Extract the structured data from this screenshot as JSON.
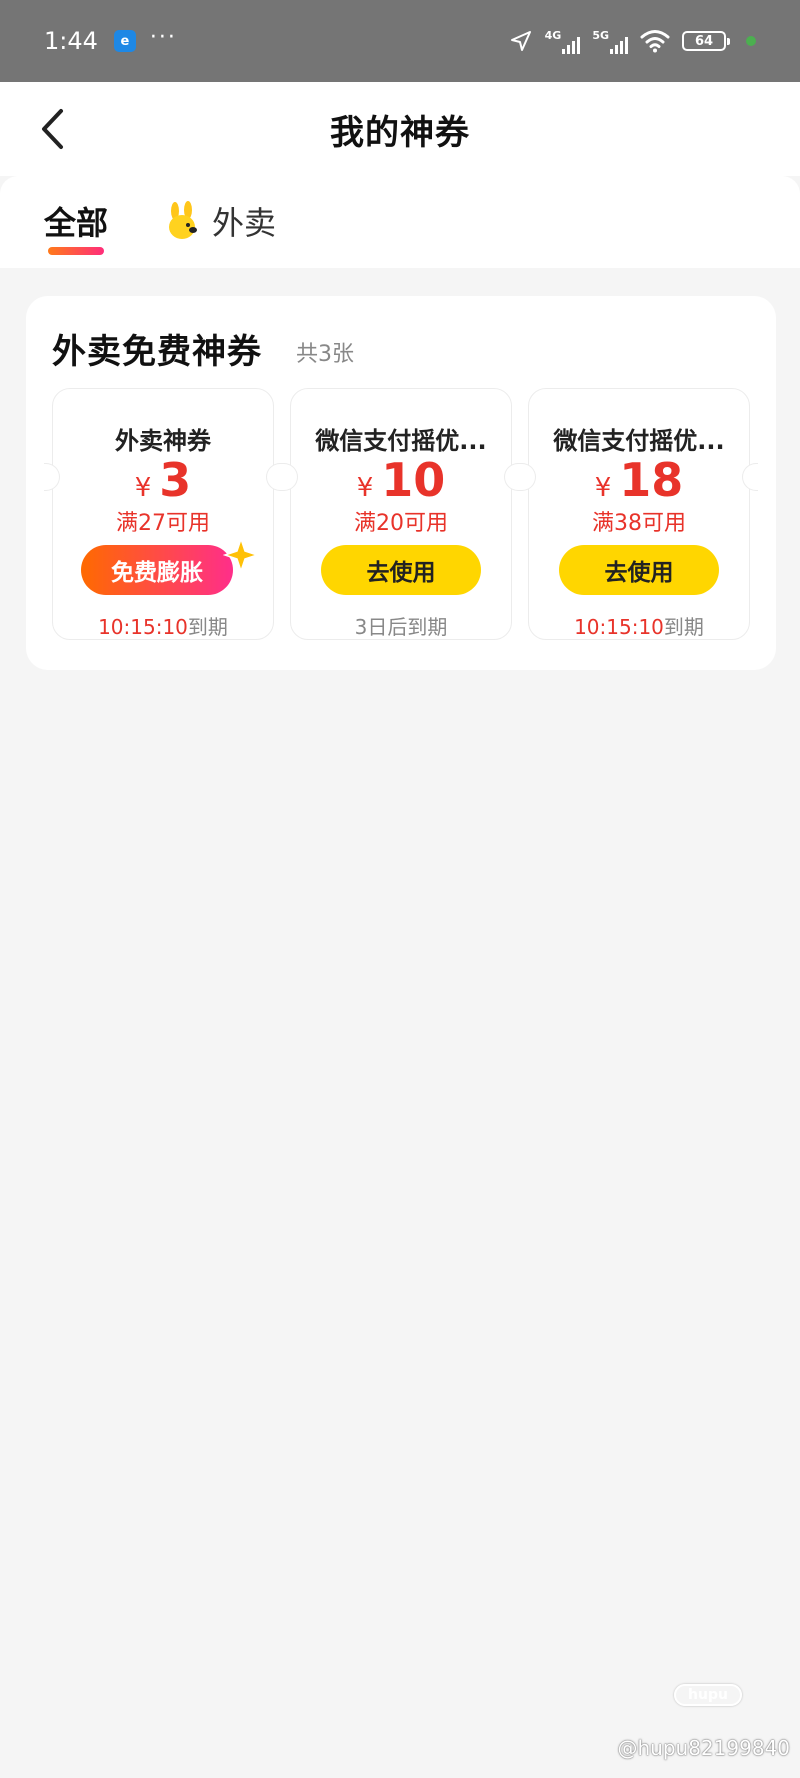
{
  "status_bar": {
    "time": "1:44",
    "app_icon_text": "e",
    "dots": "···",
    "net1": "4G",
    "net2": "5G",
    "battery": "64"
  },
  "header": {
    "title": "我的神券"
  },
  "tabs": [
    {
      "label": "全部",
      "active": true
    },
    {
      "label": "外卖",
      "active": false
    }
  ],
  "section": {
    "title": "外卖免费神券",
    "count": "共3张"
  },
  "coupons": [
    {
      "name": "外卖神券",
      "currency": "¥",
      "amount": "3",
      "condition": "满27可用",
      "button": "免费膨胀",
      "expiry": "10:15:10",
      "expiry_suffix": "到期"
    },
    {
      "name": "微信支付摇优...",
      "currency": "¥",
      "amount": "10",
      "condition": "满20可用",
      "button": "去使用",
      "expiry": "3日后到期",
      "expiry_suffix": ""
    },
    {
      "name": "微信支付摇优...",
      "currency": "¥",
      "amount": "18",
      "condition": "满38可用",
      "button": "去使用",
      "expiry": "10:15:10",
      "expiry_suffix": "到期"
    }
  ],
  "colors": {
    "accent_red": "#e8332a",
    "yellow_button": "#ffd600",
    "gradient_start": "#ff6a00",
    "gradient_end": "#ff2e8a"
  },
  "watermark": {
    "logo": "hupu",
    "text": "@hupu82199840"
  }
}
